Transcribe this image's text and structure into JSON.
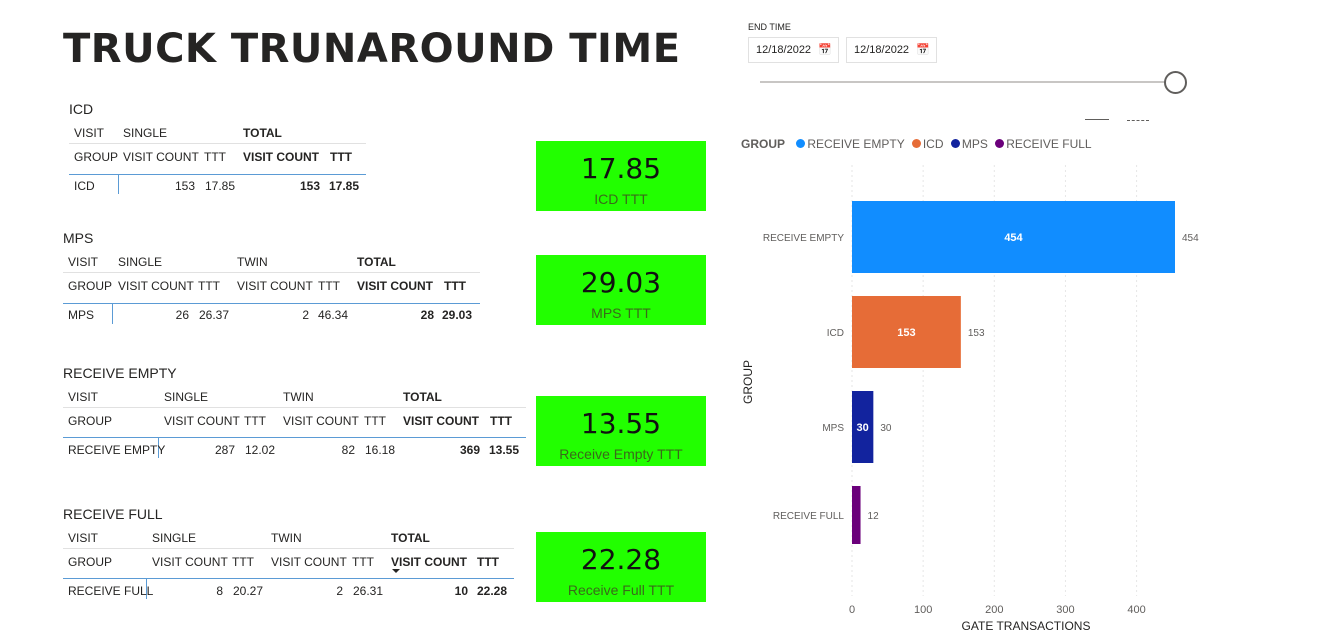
{
  "page": {
    "title": "TRUCK TRUNAROUND TIME"
  },
  "filter": {
    "label": "END TIME",
    "start_date": "12/18/2022",
    "end_date": "12/18/2022",
    "calendar_icon": "calendar-icon"
  },
  "tables": {
    "icd": {
      "title": "ICD",
      "h1": {
        "visit": "VISIT",
        "single": "SINGLE",
        "total": "TOTAL"
      },
      "h2": {
        "group": "GROUP",
        "single_vc": "VISIT COUNT",
        "single_ttt": "TTT",
        "total_vc": "VISIT COUNT",
        "total_ttt": "TTT"
      },
      "row": {
        "group": "ICD",
        "single_vc": "153",
        "single_ttt": "17.85",
        "total_vc": "153",
        "total_ttt": "17.85"
      }
    },
    "mps": {
      "title": "MPS",
      "h1": {
        "visit": "VISIT",
        "single": "SINGLE",
        "twin": "TWIN",
        "total": "TOTAL"
      },
      "h2": {
        "group": "GROUP",
        "single_vc": "VISIT COUNT",
        "single_ttt": "TTT",
        "twin_vc": "VISIT COUNT",
        "twin_ttt": "TTT",
        "total_vc": "VISIT COUNT",
        "total_ttt": "TTT"
      },
      "row": {
        "group": "MPS",
        "single_vc": "26",
        "single_ttt": "26.37",
        "twin_vc": "2",
        "twin_ttt": "46.34",
        "total_vc": "28",
        "total_ttt": "29.03"
      }
    },
    "re": {
      "title": "RECEIVE EMPTY",
      "h1": {
        "visit": "VISIT",
        "single": "SINGLE",
        "twin": "TWIN",
        "total": "TOTAL"
      },
      "h2": {
        "group": "GROUP",
        "single_vc": "VISIT COUNT",
        "single_ttt": "TTT",
        "twin_vc": "VISIT COUNT",
        "twin_ttt": "TTT",
        "total_vc": "VISIT COUNT",
        "total_ttt": "TTT"
      },
      "row": {
        "group": "RECEIVE EMPTY",
        "single_vc": "287",
        "single_ttt": "12.02",
        "twin_vc": "82",
        "twin_ttt": "16.18",
        "total_vc": "369",
        "total_ttt": "13.55"
      }
    },
    "rf": {
      "title": "RECEIVE FULL",
      "h1": {
        "visit": "VISIT",
        "single": "SINGLE",
        "twin": "TWIN",
        "total": "TOTAL"
      },
      "h2": {
        "group": "GROUP",
        "single_vc": "VISIT COUNT",
        "single_ttt": "TTT",
        "twin_vc": "VISIT COUNT",
        "twin_ttt": "TTT",
        "total_vc": "VISIT COUNT",
        "total_ttt": "TTT"
      },
      "row": {
        "group": "RECEIVE FULL",
        "single_vc": "8",
        "single_ttt": "20.27",
        "twin_vc": "2",
        "twin_ttt": "26.31",
        "total_vc": "10",
        "total_ttt": "22.28"
      }
    }
  },
  "cards": {
    "icd": {
      "value": "17.85",
      "label": "ICD TTT"
    },
    "mps": {
      "value": "29.03",
      "label": "MPS TTT"
    },
    "re": {
      "value": "13.55",
      "label": "Receive Empty TTT"
    },
    "rf": {
      "value": "22.28",
      "label": "Receive Full TTT"
    }
  },
  "colors": {
    "card_bg": "#22ff00",
    "accent_line": "#5b9bd5"
  },
  "chart_data": {
    "type": "bar",
    "orientation": "horizontal",
    "legend_title": "GROUP",
    "legend_position": "top-left",
    "categories": [
      "RECEIVE EMPTY",
      "ICD",
      "MPS",
      "RECEIVE FULL"
    ],
    "values": [
      454,
      153,
      30,
      12
    ],
    "colors": [
      "#118dff",
      "#e66c37",
      "#12239e",
      "#6b007b"
    ],
    "xlabel": "GATE TRANSACTIONS",
    "ylabel": "GROUP",
    "xlim": [
      0,
      454
    ],
    "xticks": [
      0,
      100,
      200,
      300,
      400
    ],
    "grid": true
  }
}
